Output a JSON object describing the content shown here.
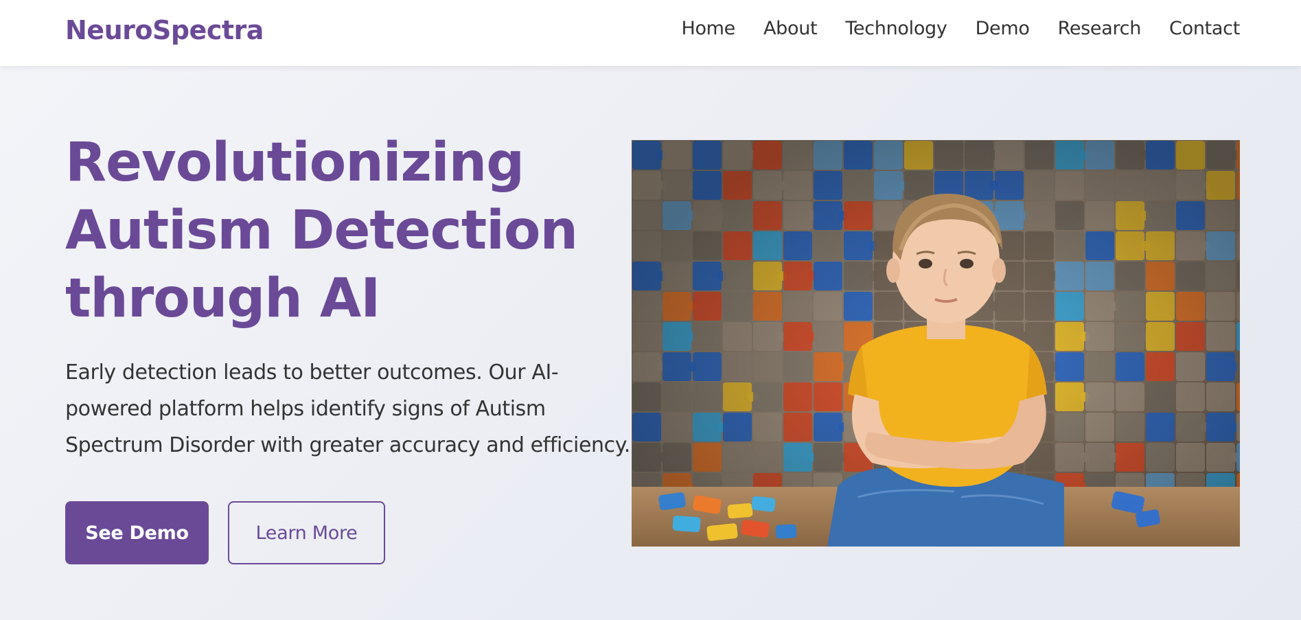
{
  "header": {
    "brand": "NeuroSpectra",
    "nav": [
      "Home",
      "About",
      "Technology",
      "Demo",
      "Research",
      "Contact"
    ]
  },
  "hero": {
    "title_lines": [
      "Revolutionizing",
      "Autism Detection",
      "through AI"
    ],
    "description_lines": [
      "Early detection leads to better outcomes. Our AI-",
      "powered platform helps identify signs of Autism",
      "Spectrum Disorder with greater accuracy and efficiency."
    ],
    "primary_button": "See Demo",
    "secondary_button": "Learn More",
    "image_icon": "child-with-puzzle-wall-photo"
  },
  "colors": {
    "brand": "#6a4a97",
    "text": "#333333",
    "background": "#eceef4",
    "header_bg": "#ffffff"
  }
}
